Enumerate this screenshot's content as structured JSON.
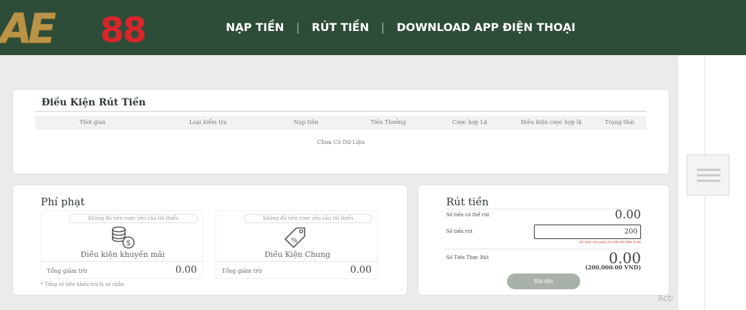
{
  "header": {
    "logo_letters": "AE",
    "logo_number": "88",
    "nav": [
      "NẠP TIỀN",
      "RÚT TIỀN",
      "DOWNLOAD APP ĐIỆN THOẠI"
    ]
  },
  "conditions": {
    "title": "Điều Kiện Rút Tiền",
    "columns": [
      "Thời gian",
      "Loại kiểm tra",
      "Nạp tiền",
      "Tiền Thưởng",
      "Cược hợp Lệ",
      "Điều kiện cược hợp lệ",
      "Trạng thái"
    ],
    "empty_text": "Chưa Có Dữ Liệu"
  },
  "penalty": {
    "title": "Phí phạt",
    "boxes": [
      {
        "pill": "Không đủ tiền cược yêu cầu tối thiểu",
        "label": "Điều kiện khuyến mãi",
        "foot_label": "Tổng giảm trừ",
        "foot_value": "0.00",
        "icon": "coins-dollar-icon"
      },
      {
        "pill": "Không đủ tiền cược yêu cầu tối thiểu",
        "label": "Điều Kiện Chung",
        "foot_label": "Tổng giảm trừ",
        "foot_value": "0.00",
        "icon": "price-tag-icon"
      }
    ],
    "footnote": "* Tổng số tiền khấu trừ là số chẵn"
  },
  "withdraw": {
    "title": "Rút tiền",
    "available_label": "Số tiền có thể rút",
    "available_value": "0.00",
    "amount_label": "Số tiền rút",
    "amount_value": "200",
    "amount_warning": "Số tiền rút phải từ 200.00 đến 0.00",
    "actual_label": "Số Tiền Thực Rút",
    "actual_value": "0.00",
    "actual_vnd": "(200,000.00 VND)",
    "button": "Rút tiền"
  },
  "watermark": "Acti",
  "colors": {
    "header_bg": "#2e4d39",
    "logo_gold": "#b99347",
    "logo_red": "#d9252b",
    "button_bg": "#a9b2a9",
    "warning": "#c33333"
  }
}
